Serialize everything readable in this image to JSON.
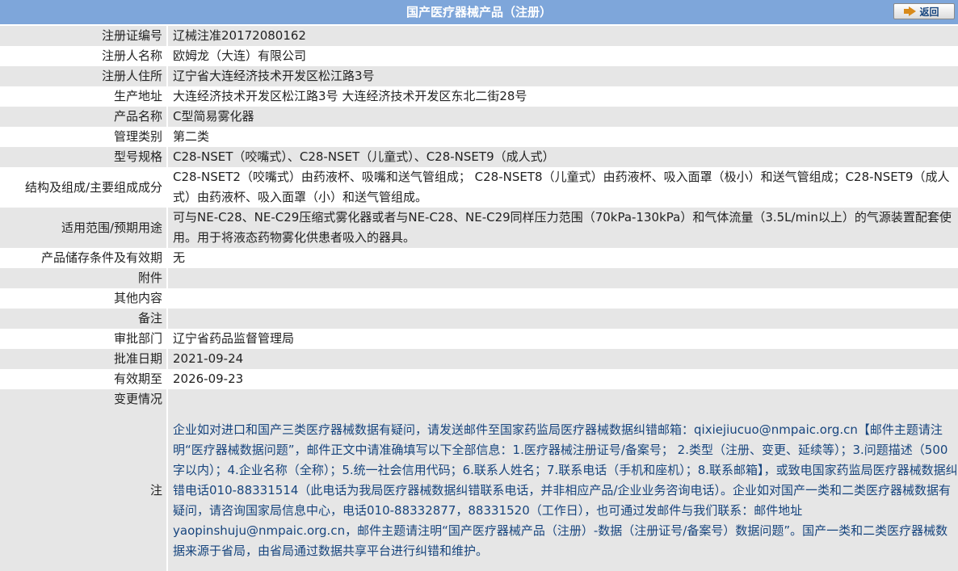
{
  "header": {
    "title": "国产医疗器械产品（注册）",
    "back_label": "返回"
  },
  "rows": [
    {
      "label": "注册证编号",
      "value": "辽械注准20172080162"
    },
    {
      "label": "注册人名称",
      "value": "欧姆龙（大连）有限公司"
    },
    {
      "label": "注册人住所",
      "value": "辽宁省大连经济技术开发区松江路3号"
    },
    {
      "label": "生产地址",
      "value": "大连经济技术开发区松江路3号 大连经济技术开发区东北二街28号"
    },
    {
      "label": "产品名称",
      "value": "C型简易雾化器"
    },
    {
      "label": "管理类别",
      "value": "第二类"
    },
    {
      "label": "型号规格",
      "value": "C28-NSET（咬嘴式）、C28-NSET（儿童式）、C28-NSET9（成人式）"
    },
    {
      "label": "结构及组成/主要组成成分",
      "value": "C28-NSET2（咬嘴式）由药液杯、吸嘴和送气管组成； C28-NSET8（儿童式）由药液杯、吸入面罩（极小）和送气管组成；C28-NSET9（成人式）由药液杯、吸入面罩（小）和送气管组成。"
    },
    {
      "label": "适用范围/预期用途",
      "value": "可与NE-C28、NE-C29压缩式雾化器或者与NE-C28、NE-C29同样压力范围（70kPa-130kPa）和气体流量（3.5L/min以上）的气源装置配套使用。用于将液态药物雾化供患者吸入的器具。"
    },
    {
      "label": "产品储存条件及有效期",
      "value": "无"
    },
    {
      "label": "附件",
      "value": ""
    },
    {
      "label": "其他内容",
      "value": ""
    },
    {
      "label": "备注",
      "value": ""
    },
    {
      "label": "审批部门",
      "value": "辽宁省药品监督管理局"
    },
    {
      "label": "批准日期",
      "value": "2021-09-24"
    },
    {
      "label": "有效期至",
      "value": "2026-09-23"
    },
    {
      "label": "变更情况",
      "value": ""
    }
  ],
  "note": {
    "label": "注",
    "text": "企业如对进口和国产三类医疗器械数据有疑问，请发送邮件至国家药监局医疗器械数据纠错邮箱：qixiejiucuo@nmpaic.org.cn【邮件主题请注明“医疗器械数据问题”，邮件正文中请准确填写以下全部信息：1.医疗器械注册证号/备案号； 2.类型（注册、变更、延续等）；3.问题描述（500字以内）；4.企业名称（全称）；5.统一社会信用代码；6.联系人姓名；7.联系电话（手机和座机）；8.联系邮箱】，或致电国家药监局医疗器械数据纠错电话010-88331514（此电话为我局医疗器械数据纠错联系电话，并非相应产品/企业业务咨询电话）。企业如对国产一类和二类医疗器械数据有疑问，请咨询国家局信息中心，电话010-88332877，88331520（工作日），也可通过发邮件与我们联系：邮件地址yaopinshuju@nmpaic.org.cn，邮件主题请注明“国产医疗器械产品（注册）-数据（注册证号/备案号）数据问题”。国产一类和二类医疗器械数据来源于省局，由省局通过数据共享平台进行纠错和维护。"
  },
  "colors": {
    "header_bg": "#7ea6da",
    "row_gray": "#e6e6e6",
    "notice_text": "#17457e"
  }
}
